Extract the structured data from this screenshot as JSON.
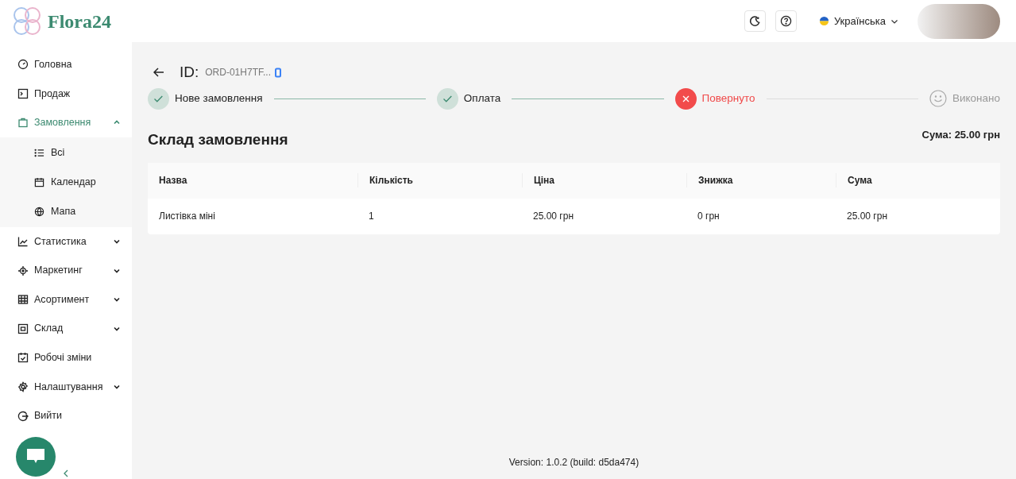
{
  "brand": "Flora24",
  "header": {
    "language": "Українська"
  },
  "sidebar": {
    "items": [
      {
        "label": "Головна",
        "expandable": false,
        "selected": false
      },
      {
        "label": "Продаж",
        "expandable": false,
        "selected": false
      },
      {
        "label": "Замовлення",
        "expandable": true,
        "expanded": true,
        "selected": true,
        "children": [
          {
            "label": "Всі"
          },
          {
            "label": "Календар"
          },
          {
            "label": "Мапа"
          }
        ]
      },
      {
        "label": "Статистика",
        "expandable": true,
        "expanded": false,
        "selected": false
      },
      {
        "label": "Маркетинг",
        "expandable": true,
        "expanded": false,
        "selected": false
      },
      {
        "label": "Асортимент",
        "expandable": true,
        "expanded": false,
        "selected": false
      },
      {
        "label": "Склад",
        "expandable": true,
        "expanded": false,
        "selected": false
      },
      {
        "label": "Робочі зміни",
        "expandable": false,
        "selected": false
      },
      {
        "label": "Налаштування",
        "expandable": true,
        "expanded": false,
        "selected": false
      },
      {
        "label": "Вийти",
        "expandable": false,
        "selected": false
      }
    ]
  },
  "order": {
    "id_label": "ID:",
    "id": "ORD-01H7TF...",
    "steps": [
      {
        "label": "Нове замовлення",
        "kind": "done"
      },
      {
        "label": "Оплата",
        "kind": "done"
      },
      {
        "label": "Повернуто",
        "kind": "failed"
      },
      {
        "label": "Виконано",
        "kind": "pending"
      }
    ],
    "title": "Склад замовлення",
    "total": "Сума: 25.00 грн",
    "table": {
      "columns": [
        "Назва",
        "Кількість",
        "Ціна",
        "Знижка",
        "Сума"
      ],
      "rows": [
        [
          "Листівка міні",
          "1",
          "25.00 грн",
          "0 грн",
          "25.00 грн"
        ]
      ]
    }
  },
  "footer": "Version: 1.0.2 (build: d5da474)"
}
